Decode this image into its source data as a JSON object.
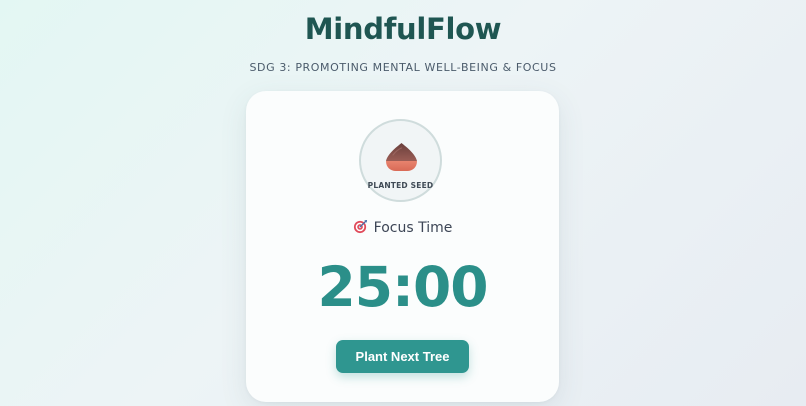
{
  "app": {
    "title": "MindfulFlow",
    "subtitle": "SDG 3: PROMOTING MENTAL WELL-BEING & FOCUS"
  },
  "growth": {
    "stage_label": "PLANTED SEED",
    "icon": "seed-icon"
  },
  "session": {
    "mode_icon": "target-icon",
    "mode_label": "Focus Time",
    "time_remaining": "25:00"
  },
  "actions": {
    "primary_label": "Plant Next Tree"
  },
  "colors": {
    "title": "#1f5652",
    "accent": "#2f9690",
    "timer": "#2b8f89",
    "card_background": "#fbfdfd"
  }
}
